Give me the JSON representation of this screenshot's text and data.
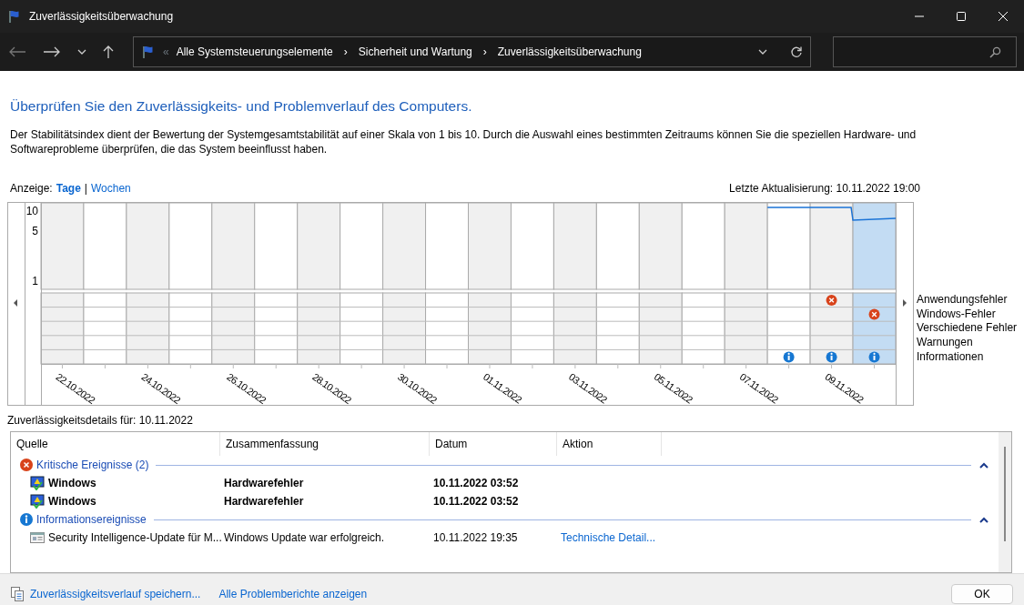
{
  "window": {
    "title": "Zuverlässigkeitsüberwachung"
  },
  "address_bar": {
    "overflow": "«",
    "path": [
      "Alle Systemsteuerungselemente",
      "Sicherheit und Wartung",
      "Zuverlässigkeitsüberwachung"
    ],
    "separator": "›"
  },
  "heading": "Überprüfen Sie den Zuverlässigkeits- und Problemverlauf des Computers.",
  "description": "Der Stabilitätsindex dient der Bewertung der Systemgesamtstabilität auf einer Skala von 1 bis 10. Durch die Auswahl eines bestimmten Zeitraums können Sie die speziellen Hardware- und Softwareprobleme überprüfen, die das System beeinflusst haben.",
  "view": {
    "label": "Anzeige:",
    "separator": "|",
    "options": [
      {
        "label": "Tage",
        "selected": true
      },
      {
        "label": "Wochen",
        "selected": false
      }
    ]
  },
  "last_update": "Letzte Aktualisierung: 10.11.2022 19:00",
  "scale_labels": [
    "10",
    "5",
    "1"
  ],
  "date_labels": [
    "22.10.2022",
    "24.10.2022",
    "26.10.2022",
    "28.10.2022",
    "30.10.2022",
    "01.11.2022",
    "03.11.2022",
    "05.11.2022",
    "07.11.2022",
    "09.11.2022"
  ],
  "days": [
    {
      "selected": false
    },
    {
      "selected": false
    },
    {
      "selected": false
    },
    {
      "selected": false
    },
    {
      "selected": false
    },
    {
      "selected": false
    },
    {
      "selected": false
    },
    {
      "selected": false
    },
    {
      "selected": false
    },
    {
      "selected": false
    },
    {
      "selected": false
    },
    {
      "selected": false
    },
    {
      "selected": false
    },
    {
      "selected": false
    },
    {
      "selected": false
    },
    {
      "selected": false
    },
    {
      "selected": false
    },
    {
      "selected": false,
      "information": true
    },
    {
      "selected": false,
      "application_error": true,
      "information": true
    },
    {
      "selected": true,
      "windows_error": true,
      "information": true
    }
  ],
  "event_rows": [
    {
      "kind": "application_error",
      "label": "Anwendungsfehler"
    },
    {
      "kind": "windows_error",
      "label": "Windows-Fehler"
    },
    {
      "kind": "misc_error",
      "label": "Verschiedene Fehler"
    },
    {
      "kind": "warning",
      "label": "Warnungen"
    },
    {
      "kind": "information",
      "label": "Informationen"
    }
  ],
  "details_title": "Zuverlässigkeitsdetails für: 10.11.2022",
  "table": {
    "columns": [
      "Quelle",
      "Zusammenfassung",
      "Datum",
      "Aktion"
    ],
    "groups": [
      {
        "kind": "critical",
        "title": "Kritische Ereignisse (2)",
        "expanded": true,
        "rows": [
          {
            "kind": "windows",
            "bold": true,
            "source": "Windows",
            "summary": "Hardwarefehler",
            "date": "10.11.2022 03:52"
          },
          {
            "kind": "windows",
            "bold": true,
            "source": "Windows",
            "summary": "Hardwarefehler",
            "date": "10.11.2022 03:52"
          }
        ]
      },
      {
        "kind": "info",
        "title": "Informationsereignisse",
        "expanded": true,
        "rows": [
          {
            "kind": "update",
            "bold": false,
            "source": "Security Intelligence-Update für M...",
            "summary": "Windows Update war erfolgreich.",
            "date": "10.11.2022 19:35",
            "action": "Technische Detail..."
          }
        ]
      }
    ]
  },
  "footer": {
    "links": [
      "Zuverlässigkeitsverlauf speichern...",
      "Alle Problemberichte anzeigen"
    ],
    "button": "OK"
  }
}
